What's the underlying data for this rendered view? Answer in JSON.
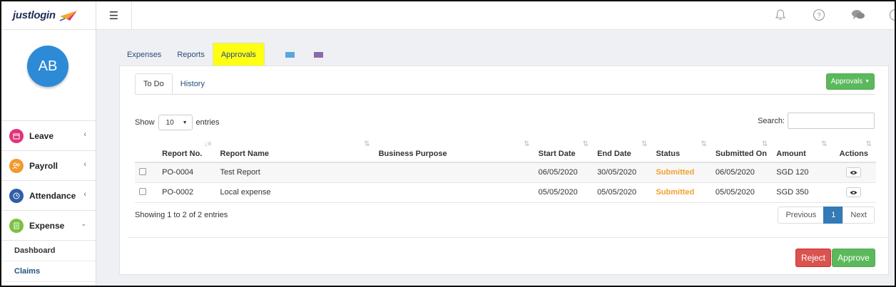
{
  "app": {
    "logo_text": "justlogin"
  },
  "user": {
    "initials": "AB"
  },
  "sidebar": {
    "items": [
      {
        "label": "Leave",
        "icon": "calendar-icon",
        "color": "#e0357a"
      },
      {
        "label": "Payroll",
        "icon": "people-icon",
        "color": "#f29a2e"
      },
      {
        "label": "Attendance",
        "icon": "clock-icon",
        "color": "#2f5fa8"
      },
      {
        "label": "Expense",
        "icon": "receipt-icon",
        "color": "#7cc142"
      }
    ],
    "sub_items": [
      {
        "label": "Dashboard"
      },
      {
        "label": "Claims"
      }
    ]
  },
  "main_tabs": [
    {
      "label": "Expenses"
    },
    {
      "label": "Reports"
    },
    {
      "label": "Approvals",
      "active": true
    }
  ],
  "swatches": [
    "#5aa6dc",
    "#8a6aab"
  ],
  "sub_tabs": [
    {
      "label": "To Do",
      "active": true
    },
    {
      "label": "History"
    }
  ],
  "approvals_button": "Approvals",
  "length_menu": {
    "show": "Show",
    "value": "10",
    "entries": "entries"
  },
  "search": {
    "label": "Search:",
    "value": ""
  },
  "table": {
    "headers": [
      "Report No.",
      "Report Name",
      "Business Purpose",
      "Start Date",
      "End Date",
      "Status",
      "Submitted On",
      "Amount",
      "Actions"
    ],
    "rows": [
      {
        "report_no": "PO-0004",
        "report_name": "Test Report",
        "business_purpose": "",
        "start_date": "06/05/2020",
        "end_date": "30/05/2020",
        "status": "Submitted",
        "submitted_on": "06/05/2020",
        "amount": "SGD 120"
      },
      {
        "report_no": "PO-0002",
        "report_name": "Local expense",
        "business_purpose": "",
        "start_date": "05/05/2020",
        "end_date": "05/05/2020",
        "status": "Submitted",
        "submitted_on": "05/05/2020",
        "amount": "SGD 350"
      }
    ]
  },
  "info": "Showing 1 to 2 of 2 entries",
  "pagination": {
    "previous": "Previous",
    "page": "1",
    "next": "Next"
  },
  "actions": {
    "reject": "Reject",
    "approve": "Approve"
  }
}
